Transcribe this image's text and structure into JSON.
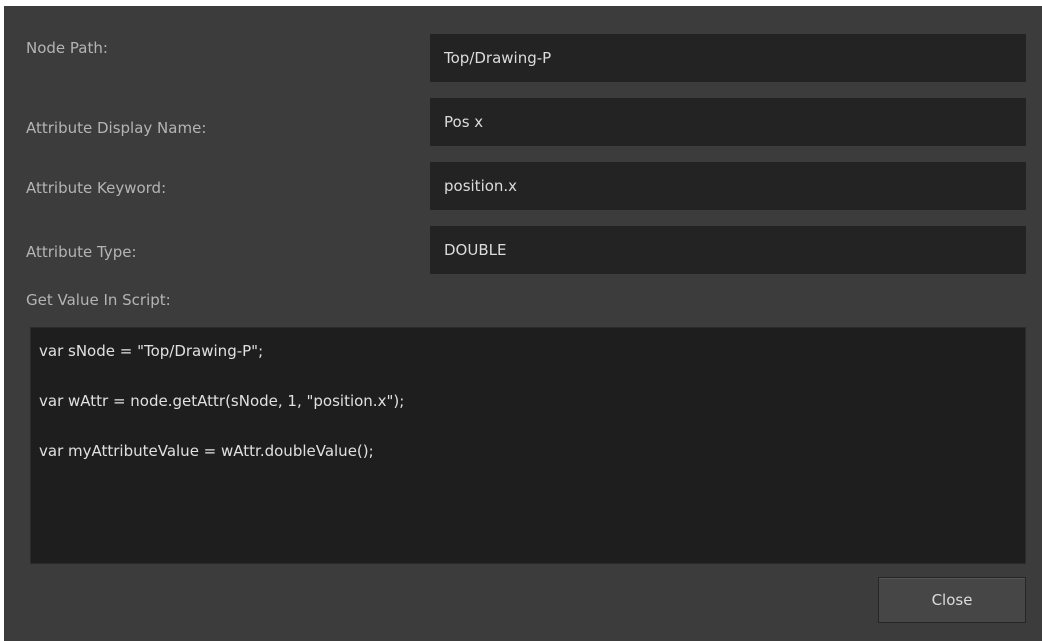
{
  "form": {
    "node_path": {
      "label": "Node Path:",
      "value": "Top/Drawing-P"
    },
    "attribute_display_name": {
      "label": "Attribute Display Name:",
      "value": "Pos x"
    },
    "attribute_keyword": {
      "label": "Attribute Keyword:",
      "value": "position.x"
    },
    "attribute_type": {
      "label": "Attribute Type:",
      "value": "DOUBLE"
    }
  },
  "script": {
    "label": "Get Value In Script:",
    "lines": [
      "var sNode = \"Top/Drawing-P\";",
      "var wAttr = node.getAttr(sNode, 1, \"position.x\");",
      "var myAttributeValue = wAttr.doubleValue();"
    ]
  },
  "actions": {
    "close_label": "Close"
  }
}
